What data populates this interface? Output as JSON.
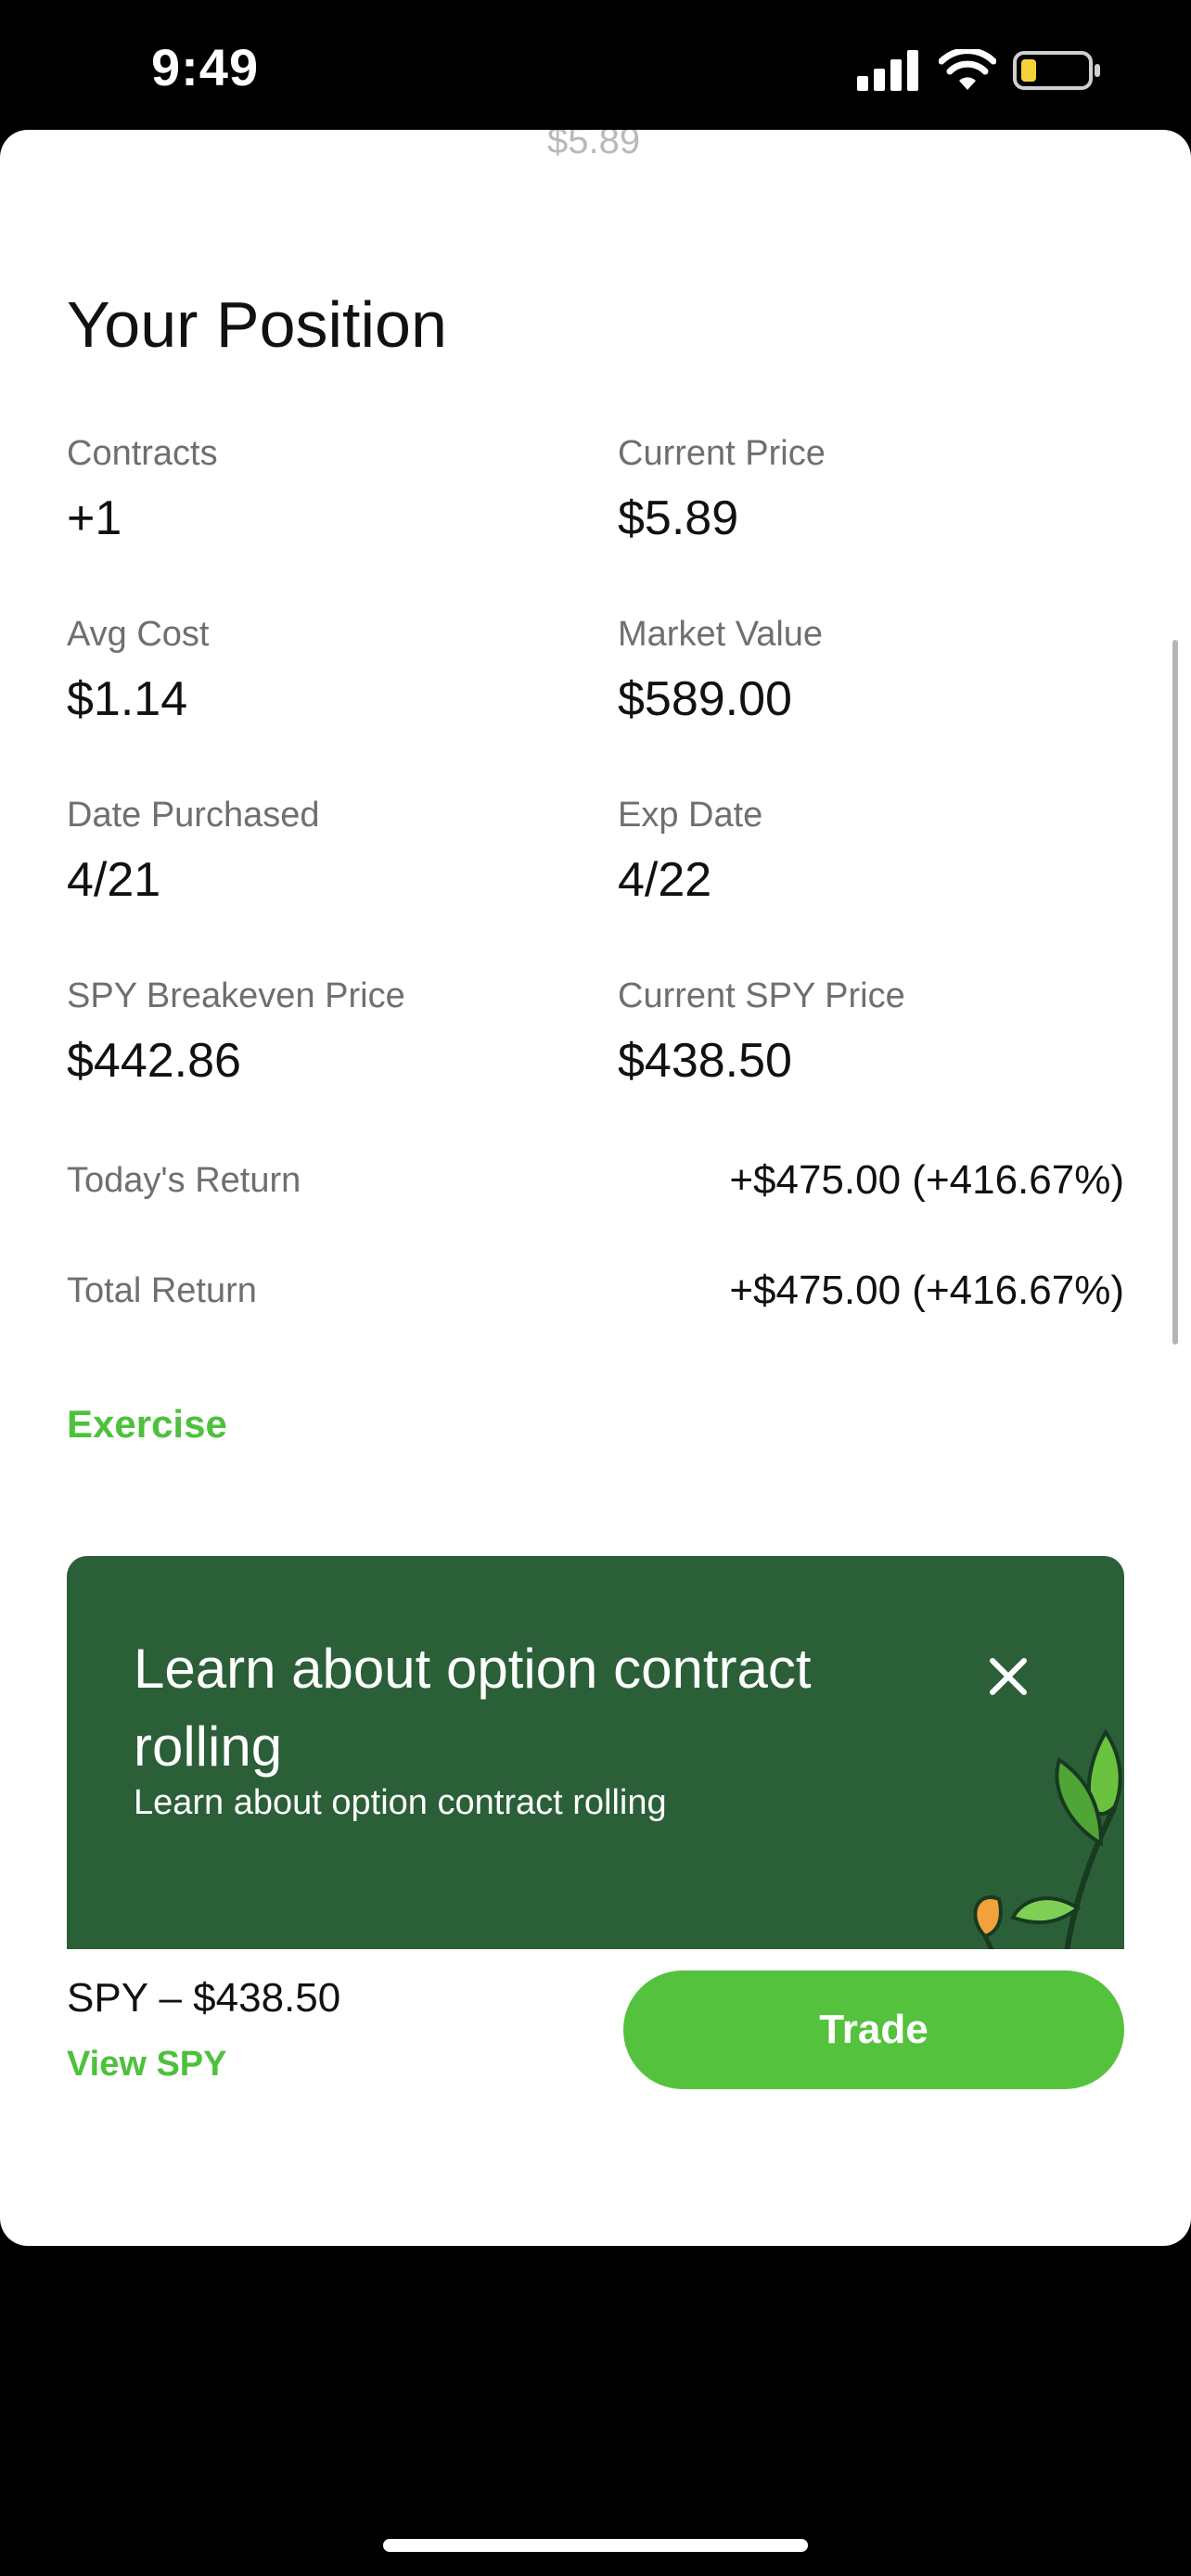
{
  "status": {
    "time": "9:49"
  },
  "ghost": {
    "price": "$5.89"
  },
  "position": {
    "title": "Your Position",
    "fields": [
      {
        "label": "Contracts",
        "value": "+1"
      },
      {
        "label": "Current Price",
        "value": "$5.89"
      },
      {
        "label": "Avg Cost",
        "value": "$1.14"
      },
      {
        "label": "Market Value",
        "value": "$589.00"
      },
      {
        "label": "Date Purchased",
        "value": "4/21"
      },
      {
        "label": "Exp Date",
        "value": "4/22"
      },
      {
        "label": "SPY Breakeven Price",
        "value": "$442.86"
      },
      {
        "label": "Current SPY Price",
        "value": "$438.50"
      }
    ],
    "todays_return": {
      "label": "Today's Return",
      "value": "+$475.00 (+416.67%)"
    },
    "total_return": {
      "label": "Total Return",
      "value": "+$475.00 (+416.67%)"
    },
    "exercise_label": "Exercise"
  },
  "promo": {
    "title": "Learn about option contract rolling",
    "subtitle": "Learn about option contract rolling",
    "close_icon": "close-icon"
  },
  "bottom_bar": {
    "symbol_price": "SPY – $438.50",
    "view_link": "View SPY",
    "trade_label": "Trade"
  },
  "colors": {
    "accent_green": "#4cc23b",
    "promo_bg": "#2b5f38",
    "trade_bg": "#55c23d"
  }
}
